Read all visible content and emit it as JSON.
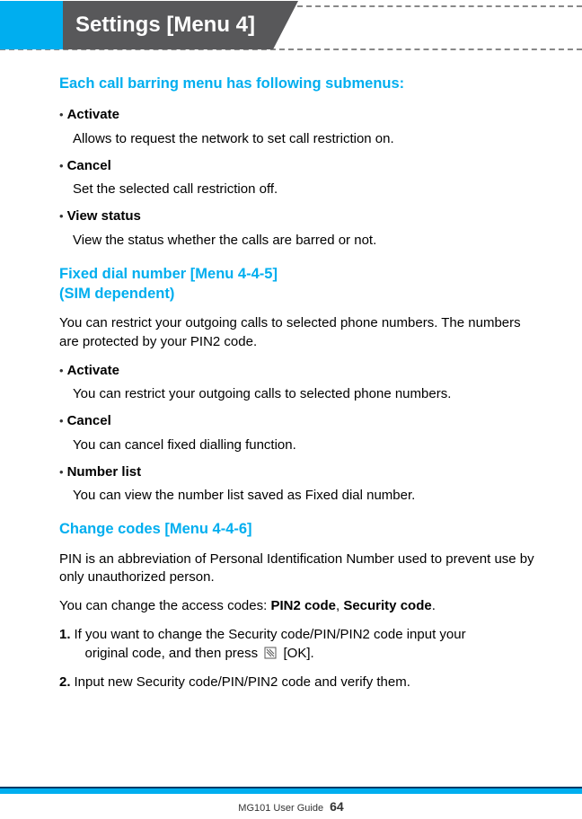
{
  "header": {
    "title": "Settings [Menu 4]"
  },
  "sections": {
    "s1_title": "Each call barring menu has following submenus:",
    "s1_items": [
      {
        "label": "Activate",
        "desc": "Allows to request the network to set call restriction on."
      },
      {
        "label": "Cancel",
        "desc": "Set the selected call restriction off."
      },
      {
        "label": "View status",
        "desc": "View the status whether the calls are barred or not."
      }
    ],
    "s2_title_a": "Fixed dial number [Menu 4-4-5]",
    "s2_title_b": "(SIM dependent)",
    "s2_intro": "You can restrict your outgoing calls to selected phone numbers. The numbers are protected by your PIN2 code.",
    "s2_items": [
      {
        "label": "Activate",
        "desc": "You can restrict your outgoing calls to selected phone numbers."
      },
      {
        "label": "Cancel",
        "desc": "You can cancel fixed dialling function."
      },
      {
        "label": "Number list",
        "desc": "You can view the number list saved as Fixed dial number."
      }
    ],
    "s3_title": "Change codes [Menu 4-4-6]",
    "s3_p1": "PIN is an abbreviation of Personal Identification Number used to prevent use by only unauthorized person.",
    "s3_p2_a": "You can change the access codes: ",
    "s3_p2_b1": "PIN2 code",
    "s3_p2_sep": ", ",
    "s3_p2_b2": "Security code",
    "s3_p2_end": ".",
    "s3_steps": [
      {
        "num": "1.",
        "text_a": "If you want to change the Security code/PIN/PIN2 code input your",
        "text_b": "original code, and then press",
        "text_c": "[OK]."
      },
      {
        "num": "2.",
        "text_a": "Input new Security code/PIN/PIN2 code and verify them."
      }
    ]
  },
  "footer": {
    "guide": "MG101 User Guide",
    "page": "64"
  }
}
